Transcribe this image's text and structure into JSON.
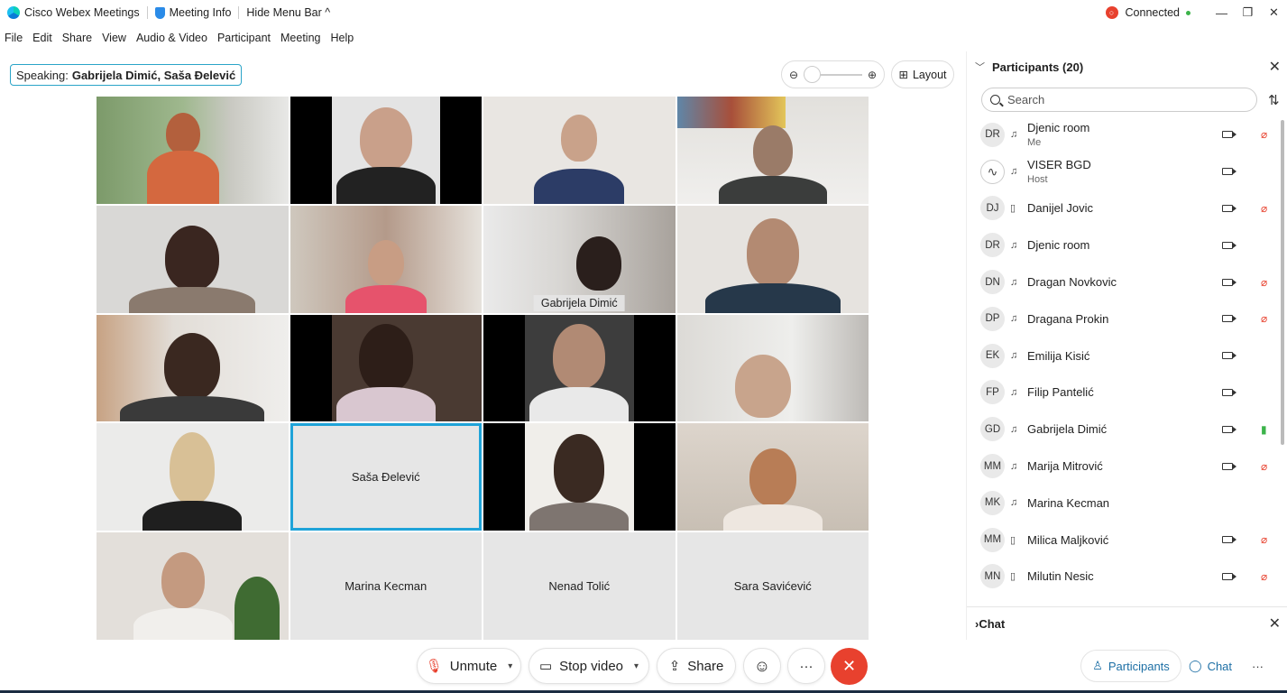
{
  "titlebar": {
    "app_name": "Cisco Webex Meetings",
    "meeting_info": "Meeting Info",
    "hide_menu": "Hide Menu Bar ^",
    "connection": "Connected",
    "minimize": "—",
    "restore": "❐",
    "close": "✕"
  },
  "menu": [
    "File",
    "Edit",
    "Share",
    "View",
    "Audio & Video",
    "Participant",
    "Meeting",
    "Help"
  ],
  "speaking": {
    "label": "Speaking:",
    "names": "Gabrijela Dimić, Saša Đelević"
  },
  "zoom": {
    "minus": "⊖",
    "plus": "⊕"
  },
  "layout_label": "Layout",
  "video_tiles": [
    {
      "label": "",
      "video": true
    },
    {
      "label": "",
      "video": true
    },
    {
      "label": "",
      "video": true
    },
    {
      "label": "",
      "video": true
    },
    {
      "label": "",
      "video": true
    },
    {
      "label": "",
      "video": true
    },
    {
      "label": "Gabrijela Dimić",
      "video": true,
      "active": true
    },
    {
      "label": "",
      "video": true
    },
    {
      "label": "",
      "video": true
    },
    {
      "label": "",
      "video": true
    },
    {
      "label": "",
      "video": true
    },
    {
      "label": "",
      "video": true
    },
    {
      "label": "",
      "video": true
    },
    {
      "label": "Saša Đelević",
      "video": false,
      "active": true
    },
    {
      "label": "",
      "video": true
    },
    {
      "label": "",
      "video": true
    },
    {
      "label": "",
      "video": true
    },
    {
      "label": "Marina Kecman",
      "video": false
    },
    {
      "label": "Nenad Tolić",
      "video": false
    },
    {
      "label": "Sara Savićević",
      "video": false
    }
  ],
  "participants_panel": {
    "title": "Participants (20)",
    "search_placeholder": "Search",
    "items": [
      {
        "initials": "DR",
        "name": "Djenic room",
        "role": "Me",
        "device": "audio",
        "camera": true,
        "mic": "muted"
      },
      {
        "initials": "",
        "name": "VISER BGD",
        "role": "Host",
        "device": "audio",
        "camera": true,
        "mic": "none"
      },
      {
        "initials": "DJ",
        "name": "Danijel Jovic",
        "role": "",
        "device": "phone",
        "camera": true,
        "mic": "muted"
      },
      {
        "initials": "DR",
        "name": "Djenic room",
        "role": "",
        "device": "audio",
        "camera": true,
        "mic": "none"
      },
      {
        "initials": "DN",
        "name": "Dragan Novkovic",
        "role": "",
        "device": "audio",
        "camera": true,
        "mic": "muted"
      },
      {
        "initials": "DP",
        "name": "Dragana Prokin",
        "role": "",
        "device": "audio",
        "camera": true,
        "mic": "muted"
      },
      {
        "initials": "EK",
        "name": "Emilija Kisić",
        "role": "",
        "device": "audio",
        "camera": true,
        "mic": "none"
      },
      {
        "initials": "FP",
        "name": "Filip Pantelić",
        "role": "",
        "device": "audio",
        "camera": true,
        "mic": "none"
      },
      {
        "initials": "GD",
        "name": "Gabrijela Dimić",
        "role": "",
        "device": "audio",
        "camera": true,
        "mic": "active"
      },
      {
        "initials": "MM",
        "name": "Marija Mitrović",
        "role": "",
        "device": "audio",
        "camera": true,
        "mic": "muted"
      },
      {
        "initials": "MK",
        "name": "Marina Kecman",
        "role": "",
        "device": "audio",
        "camera": false,
        "mic": "none"
      },
      {
        "initials": "MM",
        "name": "Milica Maljković",
        "role": "",
        "device": "phone",
        "camera": true,
        "mic": "muted"
      },
      {
        "initials": "MN",
        "name": "Milutin Nesic",
        "role": "",
        "device": "phone",
        "camera": true,
        "mic": "muted"
      }
    ]
  },
  "chat_panel": {
    "title": "Chat"
  },
  "controls": {
    "unmute": "Unmute",
    "stop_video": "Stop video",
    "share": "Share",
    "more": "···"
  },
  "bottom_tabs": {
    "participants": "Participants",
    "chat": "Chat",
    "more": "···"
  },
  "colors": {
    "accent": "#1fa3d8",
    "end_call": "#e8412e",
    "muted_mic": "#e8412e",
    "active_mic": "#3cb34a",
    "link_blue": "#1d6fa5"
  }
}
